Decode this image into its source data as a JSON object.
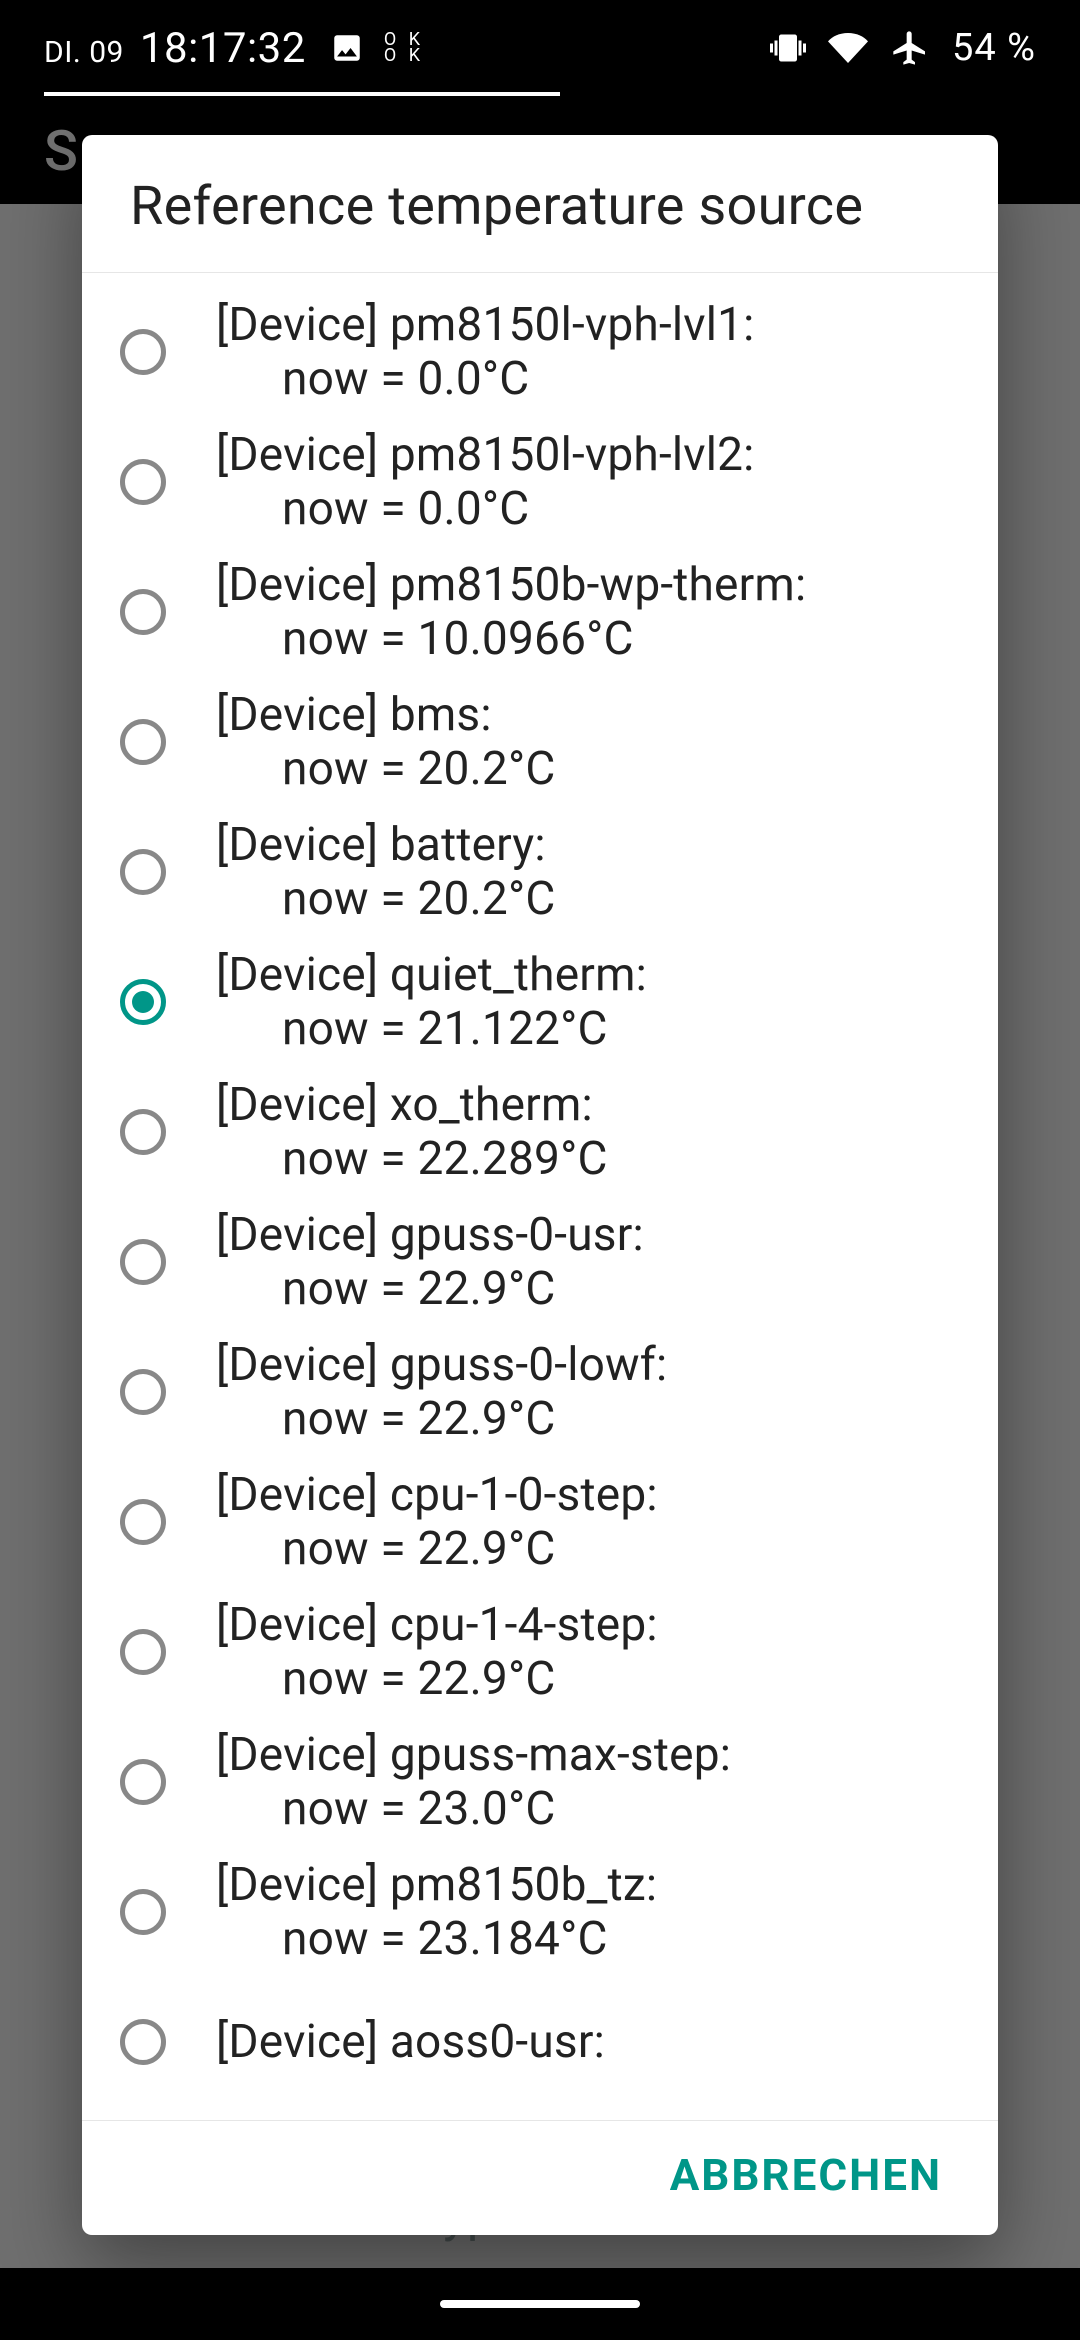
{
  "statusbar": {
    "date": "DI. 09",
    "time": "18:17:32",
    "ok_label_top": "O K",
    "ok_label_bottom": "O K",
    "battery_pct": "54 %"
  },
  "background": {
    "header_letter": "S",
    "condition_label": "Condition Type"
  },
  "dialog": {
    "title": "Reference temperature source",
    "cancel_label": "ABBRECHEN",
    "truncated_prev": "now = 0.0°C",
    "options": [
      {
        "line1": "[Device] pm8150l-vph-lvl1:",
        "line2": "now = 0.0°C",
        "selected": false
      },
      {
        "line1": "[Device] pm8150l-vph-lvl2:",
        "line2": "now = 0.0°C",
        "selected": false
      },
      {
        "line1": "[Device] pm8150b-wp-therm:",
        "line2": "now = 10.0966°C",
        "selected": false
      },
      {
        "line1": "[Device] bms:",
        "line2": "now = 20.2°C",
        "selected": false
      },
      {
        "line1": "[Device] battery:",
        "line2": "now = 20.2°C",
        "selected": false
      },
      {
        "line1": "[Device] quiet_therm:",
        "line2": "now = 21.122°C",
        "selected": true
      },
      {
        "line1": "[Device] xo_therm:",
        "line2": "now = 22.289°C",
        "selected": false
      },
      {
        "line1": "[Device] gpuss-0-usr:",
        "line2": "now = 22.9°C",
        "selected": false
      },
      {
        "line1": "[Device] gpuss-0-lowf:",
        "line2": "now = 22.9°C",
        "selected": false
      },
      {
        "line1": "[Device] cpu-1-0-step:",
        "line2": "now = 22.9°C",
        "selected": false
      },
      {
        "line1": "[Device] cpu-1-4-step:",
        "line2": "now = 22.9°C",
        "selected": false
      },
      {
        "line1": "[Device] gpuss-max-step:",
        "line2": "now = 23.0°C",
        "selected": false
      },
      {
        "line1": "[Device] pm8150b_tz:",
        "line2": "now = 23.184°C",
        "selected": false
      },
      {
        "line1": "[Device] aoss0-usr:",
        "line2": "",
        "selected": false
      }
    ]
  }
}
